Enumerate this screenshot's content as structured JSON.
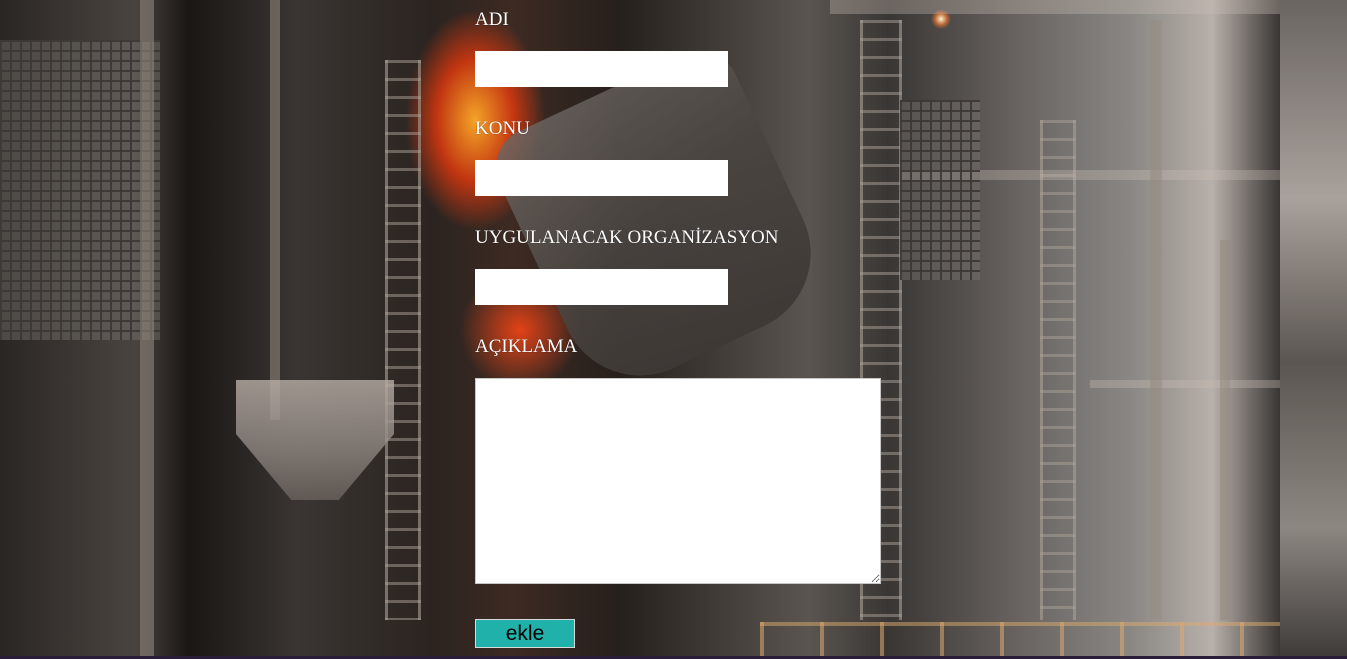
{
  "background": {
    "image": "industrial-steel-plant-photo"
  },
  "form": {
    "fields": [
      {
        "label": "ADI",
        "value": "",
        "placeholder": ""
      },
      {
        "label": "KONU",
        "value": "",
        "placeholder": ""
      },
      {
        "label": "UYGULANACAK ORGANİZASYON",
        "value": "",
        "placeholder": ""
      }
    ],
    "description": {
      "label": "AÇIKLAMA",
      "value": "",
      "placeholder": ""
    },
    "submit_label": "ekle",
    "submit_color": "#20b2aa",
    "label_color": "#ffffff"
  }
}
